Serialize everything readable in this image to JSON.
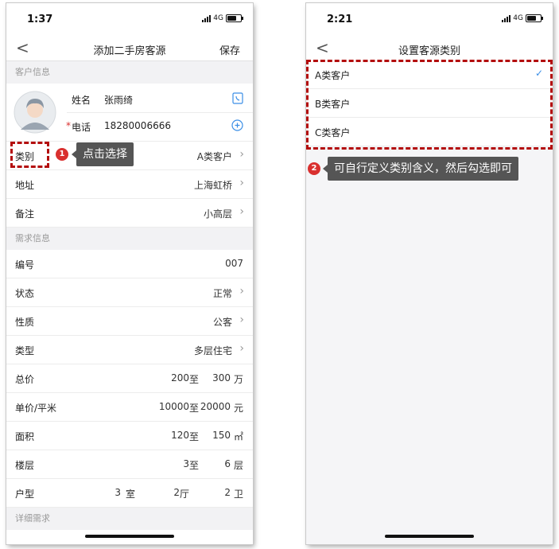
{
  "left": {
    "status": {
      "time": "1:37",
      "network": "4G"
    },
    "nav": {
      "back": "<",
      "title": "添加二手房客源",
      "action": "保存"
    },
    "section_customer": "客户信息",
    "customer": {
      "name_label": "姓名",
      "name_value": "张雨绮",
      "phone_required": "*",
      "phone_label": "电话",
      "phone_value": "18280006666"
    },
    "rows1": [
      {
        "label": "类别",
        "value": "A类客户"
      },
      {
        "label": "地址",
        "value": "上海虹桥"
      },
      {
        "label": "备注",
        "value": "小高层"
      }
    ],
    "section_demand": "需求信息",
    "number": {
      "label": "编号",
      "value": "007"
    },
    "status_row": {
      "label": "状态",
      "value": "正常"
    },
    "nature": {
      "label": "性质",
      "value": "公客"
    },
    "type": {
      "label": "类型",
      "value": "多层住宅"
    },
    "total": {
      "label": "总价",
      "from": "200",
      "to_word": "至",
      "to": "300",
      "unit": "万"
    },
    "unit_price": {
      "label": "单价/平米",
      "from": "10000",
      "to_word": "至",
      "to": "20000",
      "unit": "元"
    },
    "area": {
      "label": "面积",
      "from": "120",
      "to_word": "至",
      "to": "150",
      "unit": "㎡"
    },
    "floor": {
      "label": "楼层",
      "from": "3",
      "to_word": "至",
      "to": "6",
      "unit": "层"
    },
    "layout": {
      "label": "户型",
      "rooms": "3",
      "rooms_unit": "室",
      "halls": "2",
      "halls_unit": "厅",
      "baths": "2",
      "baths_unit": "卫"
    },
    "section_detail": "详细需求",
    "callout": {
      "num": "1",
      "text": "点击选择"
    }
  },
  "right": {
    "status": {
      "time": "2:21",
      "network": "4G"
    },
    "nav": {
      "back": "<",
      "title": "设置客源类别"
    },
    "options": [
      {
        "label": "A类客户",
        "check": "✓"
      },
      {
        "label": "B类客户"
      },
      {
        "label": "C类客户"
      }
    ],
    "callout": {
      "num": "2",
      "text": "可自行定义类别含义，然后勾选即可"
    }
  },
  "colors": {
    "annotation_red": "#b30d0d",
    "badge_red": "#d9302f",
    "callout_bg": "#555555",
    "accent_blue": "#3a8ee6"
  },
  "icons": {
    "contact": "contact-book-icon",
    "add": "plus-circle-icon",
    "chevron": "chevron-right-icon",
    "check": "checkmark-icon"
  }
}
